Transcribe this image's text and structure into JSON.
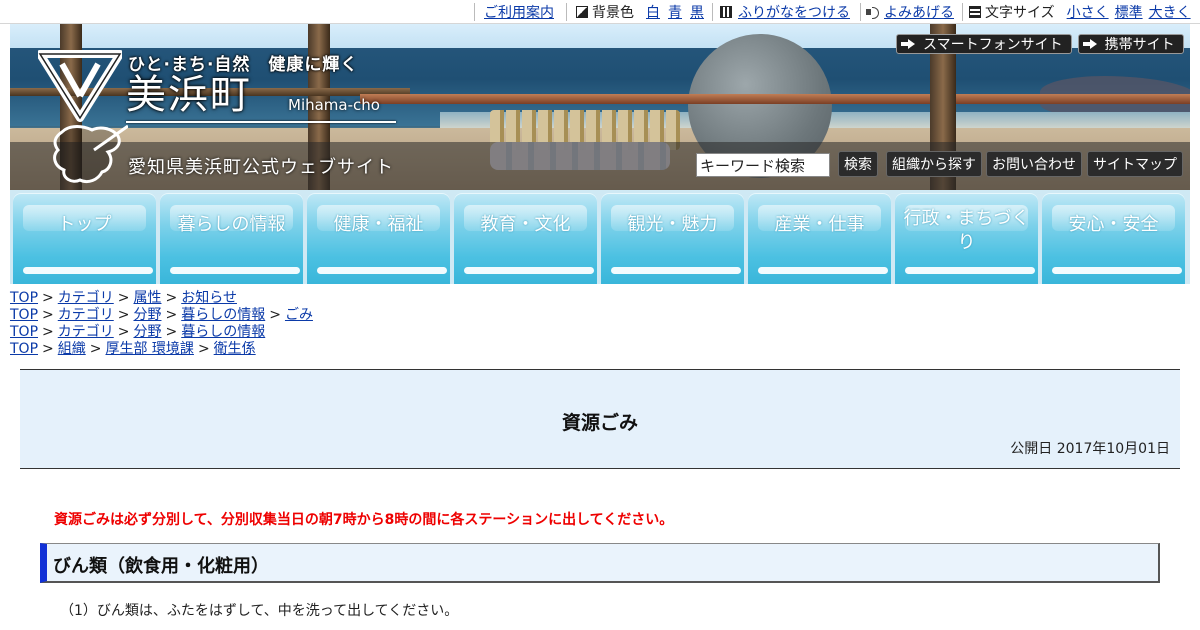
{
  "utility": {
    "usage_guide": "ご利用案内",
    "bg_color_label": "背景色",
    "bg_white": "白",
    "bg_blue": "青",
    "bg_black": "黒",
    "furigana": "ふりがなをつける",
    "read_aloud": "よみあげる",
    "font_size_label": "文字サイズ",
    "font_small": "小さく",
    "font_normal": "標準",
    "font_large": "大きく"
  },
  "header": {
    "slogan": "ひと·まち·自然　健康に輝く",
    "town_name": "美浜町",
    "romaji": "Mihama-cho",
    "site_subtitle": "愛知県美浜町公式ウェブサイト",
    "smartphone_link": "スマートフォンサイト",
    "mobile_link": "携帯サイト",
    "search_placeholder": "キーワード検索",
    "search_button": "検索",
    "org_search": "組織から探す",
    "contact": "お問い合わせ",
    "sitemap": "サイトマップ"
  },
  "nav": [
    {
      "label": "トップ"
    },
    {
      "label": "暮らしの情報"
    },
    {
      "label": "健康・福祉"
    },
    {
      "label": "教育・文化"
    },
    {
      "label": "観光・魅力"
    },
    {
      "label": "産業・仕事"
    },
    {
      "label": "行政・まちづくり"
    },
    {
      "label": "安心・安全"
    }
  ],
  "breadcrumbs": [
    [
      "TOP",
      "カテゴリ",
      "属性",
      "お知らせ"
    ],
    [
      "TOP",
      "カテゴリ",
      "分野",
      "暮らしの情報",
      "ごみ"
    ],
    [
      "TOP",
      "カテゴリ",
      "分野",
      "暮らしの情報"
    ],
    [
      "TOP",
      "組織",
      "厚生部 環境課",
      "衛生係"
    ]
  ],
  "page": {
    "title": "資源ごみ",
    "published": "公開日 2017年10月01日",
    "notice": "資源ごみは必ず分別して、分別収集当日の朝7時から8時の間に各ステーションに出してください。",
    "section_title": "びん類（飲食用・化粧用）",
    "paragraph_1": "（1）びん類は、ふたをはずして、中を洗って出してください。"
  }
}
